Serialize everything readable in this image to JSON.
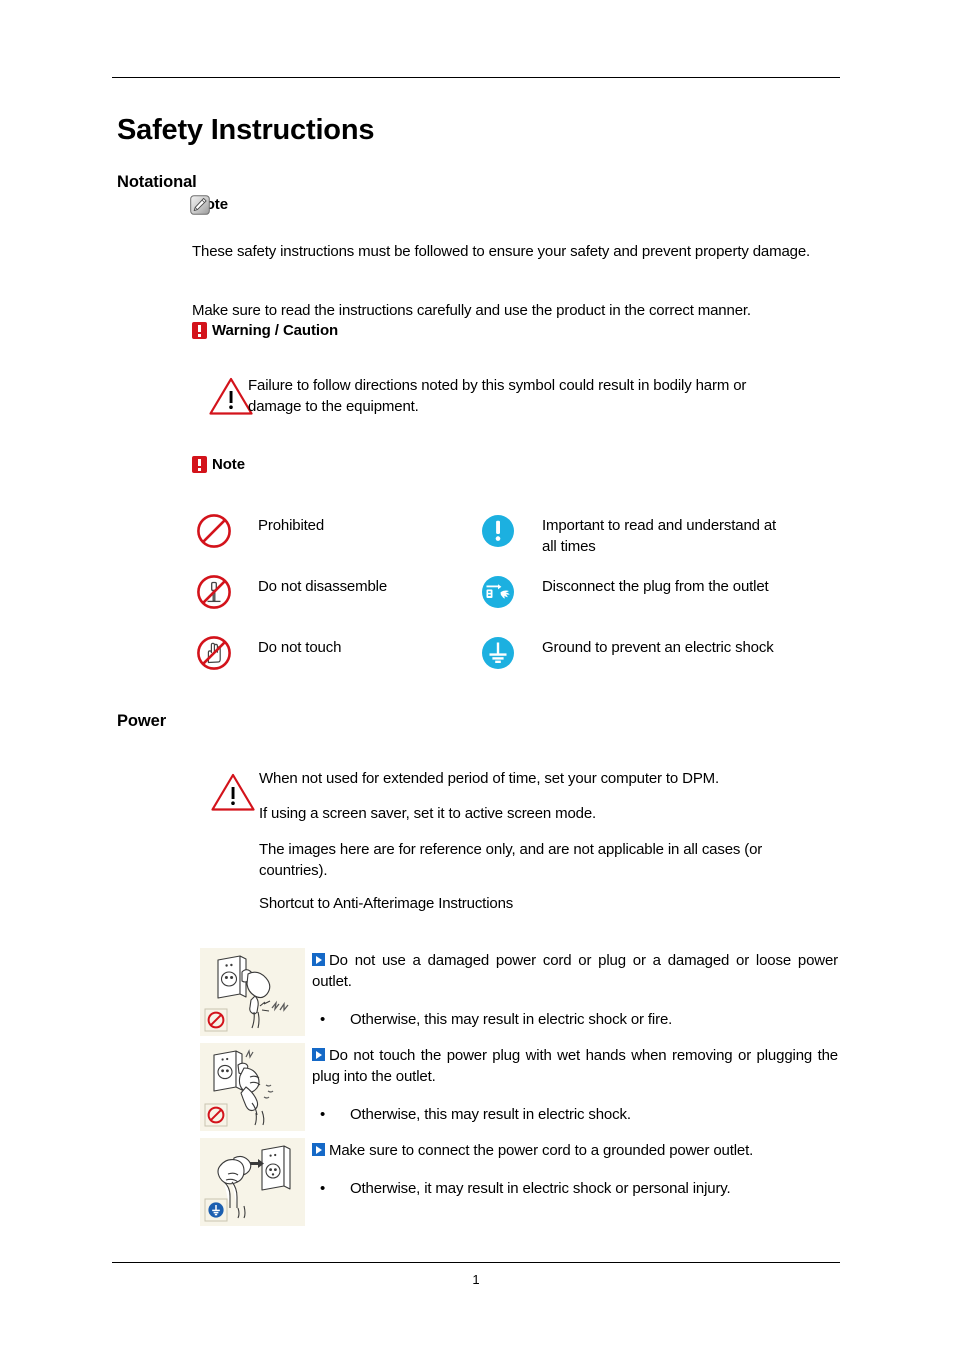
{
  "document": {
    "title": "Safety Instructions",
    "page_number": "1"
  },
  "sections": {
    "notational": {
      "heading": "Notational",
      "note_label": "Note",
      "note_icon": "memo-pencil-icon",
      "paragraph_1": "These safety instructions must be followed to ensure your safety and prevent property damage.",
      "paragraph_2": "Make sure to read the instructions carefully and use the product in the correct manner.",
      "warning_caution_label": "Warning / Caution",
      "warning_caution_icon": "red-exclamation-icon",
      "warning_text": "Failure to follow directions noted by this symbol could result in bodily harm or damage to the equipment.",
      "warning_icon": "warning-triangle-icon",
      "note_label_2": "Note",
      "note_icon_2": "red-exclamation-icon"
    },
    "legend": {
      "left_column": [
        {
          "icon": "prohibited-icon",
          "label": "Prohibited"
        },
        {
          "icon": "do-not-disassemble-icon",
          "label": "Do not disassemble"
        },
        {
          "icon": "do-not-touch-icon",
          "label": "Do not touch"
        }
      ],
      "right_column": [
        {
          "icon": "important-exclamation-icon",
          "label": "Important to read and understand at all times"
        },
        {
          "icon": "disconnect-plug-icon",
          "label": "Disconnect the plug from the outlet"
        },
        {
          "icon": "ground-icon",
          "label": "Ground to prevent an electric shock"
        }
      ]
    },
    "power": {
      "heading": "Power",
      "warning_icon": "warning-triangle-icon",
      "line_1": "When not used for extended period of time, set your computer to DPM.",
      "line_2": "If using a screen saver, set it to active screen mode.",
      "line_3": "The images here are for reference only, and are not applicable in all cases (or countries).",
      "line_4": "Shortcut to Anti-Afterimage Instructions",
      "instructions": [
        {
          "illustration": "damaged-plug-and-outlet-illustration",
          "badge": "prohibited-badge",
          "main": "Do not use a damaged power cord or plug or a damaged or loose power outlet.",
          "bullet": "•",
          "sub": "Otherwise, this may result in electric shock or fire."
        },
        {
          "illustration": "wet-hands-plug-illustration",
          "badge": "prohibited-badge",
          "main": "Do not touch the power plug with wet hands when removing or plugging the plug into the outlet.",
          "bullet": "•",
          "sub": "Otherwise, this may result in electric shock."
        },
        {
          "illustration": "grounded-outlet-illustration",
          "badge": "ground-badge",
          "main": "Make sure to connect the power cord to a grounded power outlet.",
          "bullet": "•",
          "sub": "Otherwise, it may result in electric shock or personal injury."
        }
      ]
    }
  },
  "colors": {
    "prohibition_red": "#D3131B",
    "icon_blue": "#1CB0E0",
    "marker_blue": "#1569C7",
    "illustration_bg": "#F7F4E8",
    "text": "#000000"
  }
}
